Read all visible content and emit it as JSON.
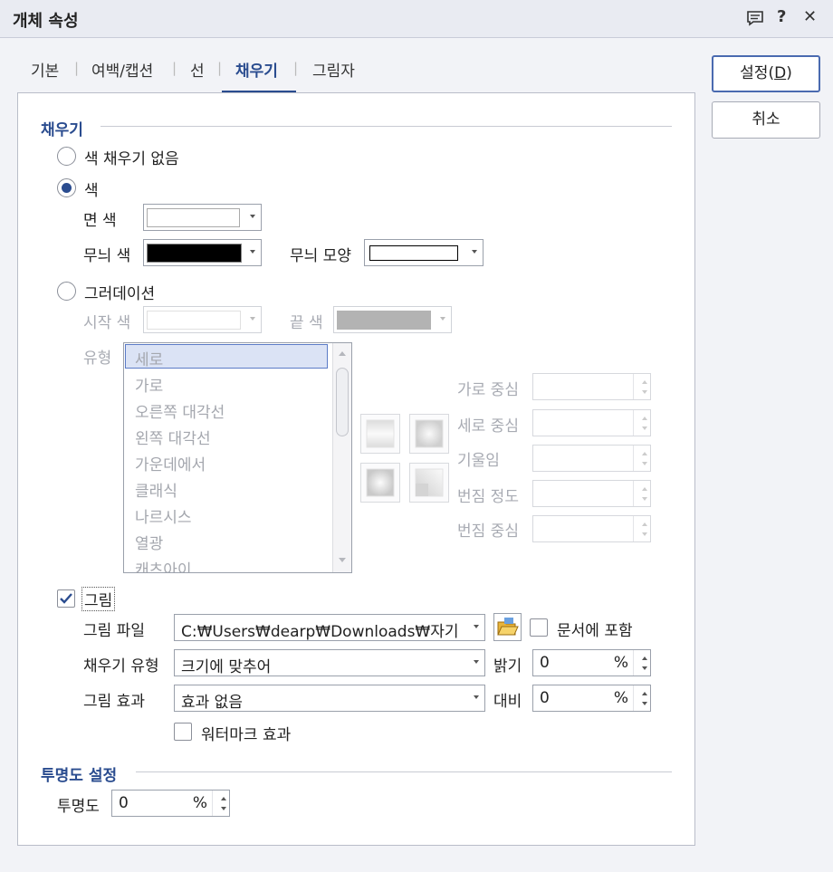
{
  "window": {
    "title": "개체 속성",
    "icons": [
      "comment-icon",
      "help-icon",
      "close-icon"
    ]
  },
  "tabs": [
    {
      "label": "기본"
    },
    {
      "label": "여백/캡션"
    },
    {
      "label": "선"
    },
    {
      "label": "채우기",
      "active": true
    },
    {
      "label": "그림자"
    }
  ],
  "buttons": {
    "ok": "설정(D)",
    "ok_mnemonic": "D",
    "cancel": "취소"
  },
  "fill": {
    "section_title": "채우기",
    "no_fill_label": "색 채우기 없음",
    "color_label": "색",
    "face_color_label": "면 색",
    "face_color": "#ffffff",
    "pattern_color_label": "무늬 색",
    "pattern_color": "#000000",
    "pattern_shape_label": "무늬 모양",
    "gradient_label": "그러데이션",
    "start_color_label": "시작 색",
    "end_color_label": "끝 색",
    "end_color": "#b3b3b3",
    "type_label": "유형",
    "types": [
      "세로",
      "가로",
      "오른쪽 대각선",
      "왼쪽 대각선",
      "가운데에서",
      "클래식",
      "나르시스",
      "열광",
      "캐츠아이"
    ],
    "selected_type": "세로",
    "h_center_label": "가로 중심",
    "v_center_label": "세로 중심",
    "tilt_label": "기울임",
    "spread_label": "번짐 정도",
    "spread_center_label": "번짐 중심"
  },
  "picture": {
    "label": "그림",
    "checked": true,
    "file_label": "그림 파일",
    "file_value": "C:₩Users₩dearp₩Downloads₩자기",
    "include_label": "문서에 포함",
    "fill_type_label": "채우기 유형",
    "fill_type_value": "크기에 맞추어",
    "brightness_label": "밝기",
    "brightness": "0",
    "effect_label": "그림 효과",
    "effect_value": "효과 없음",
    "contrast_label": "대비",
    "contrast": "0",
    "watermark_label": "워터마크 효과",
    "unit": "%"
  },
  "transparency": {
    "section_title": "투명도 설정",
    "label": "투명도",
    "value": "0",
    "unit": "%"
  }
}
